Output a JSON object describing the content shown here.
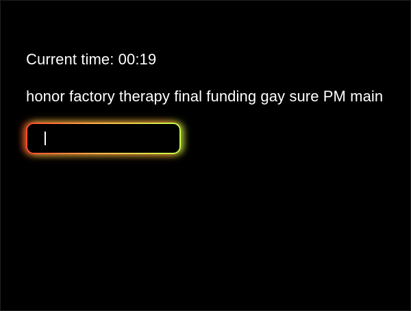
{
  "timer": {
    "label": "Current time: 00:19"
  },
  "prompt": {
    "words": "honor factory therapy final funding gay sure PM main"
  },
  "typing_input": {
    "value": "",
    "placeholder": ""
  },
  "colors": {
    "background": "#000000",
    "text": "#ffffff",
    "glow_left": "#ff4a2e",
    "glow_right": "#c6ff4a"
  }
}
